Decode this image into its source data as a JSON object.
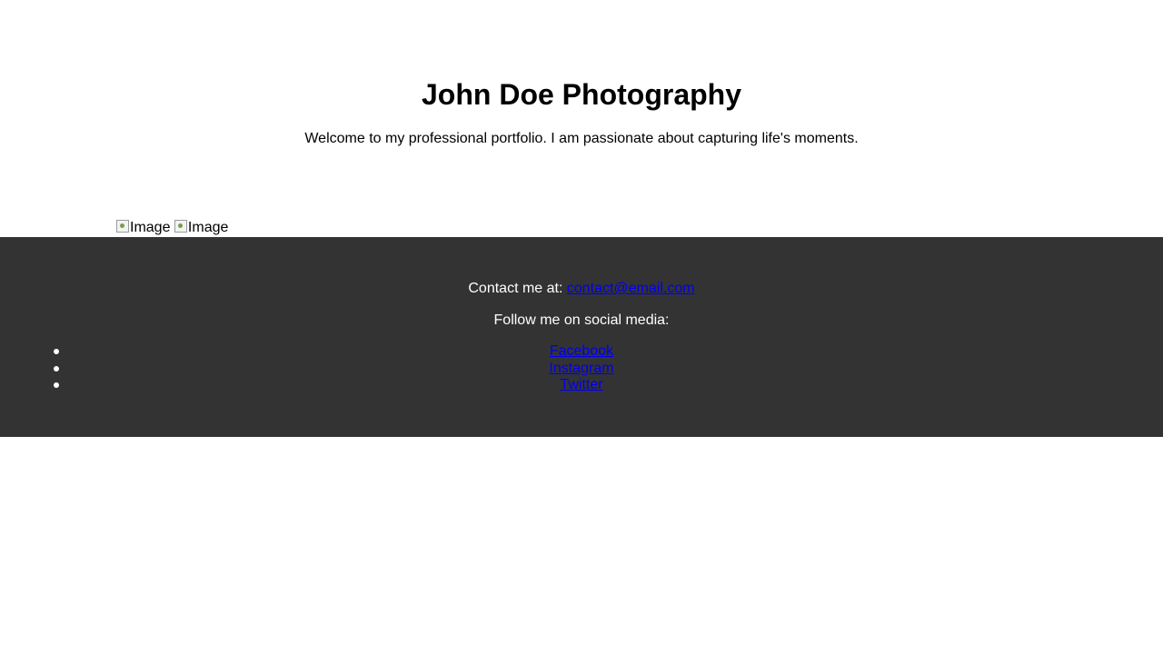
{
  "header": {
    "title": "John Doe Photography",
    "intro": "Welcome to my professional portfolio. I am passionate about capturing life's moments."
  },
  "gallery": {
    "images": [
      {
        "alt": "Image",
        "icon": "broken-image-icon"
      },
      {
        "alt": "Image",
        "icon": "broken-image-icon"
      }
    ]
  },
  "footer": {
    "contact_label": "Contact me at:",
    "contact_email": "contact@email.com",
    "follow_label": "Follow me on social media:",
    "social_links": [
      {
        "label": "Facebook"
      },
      {
        "label": "Instagram"
      },
      {
        "label": "Twitter"
      }
    ],
    "background_color": "#333333",
    "text_color": "#ffffff",
    "link_color": "#0000ee"
  }
}
